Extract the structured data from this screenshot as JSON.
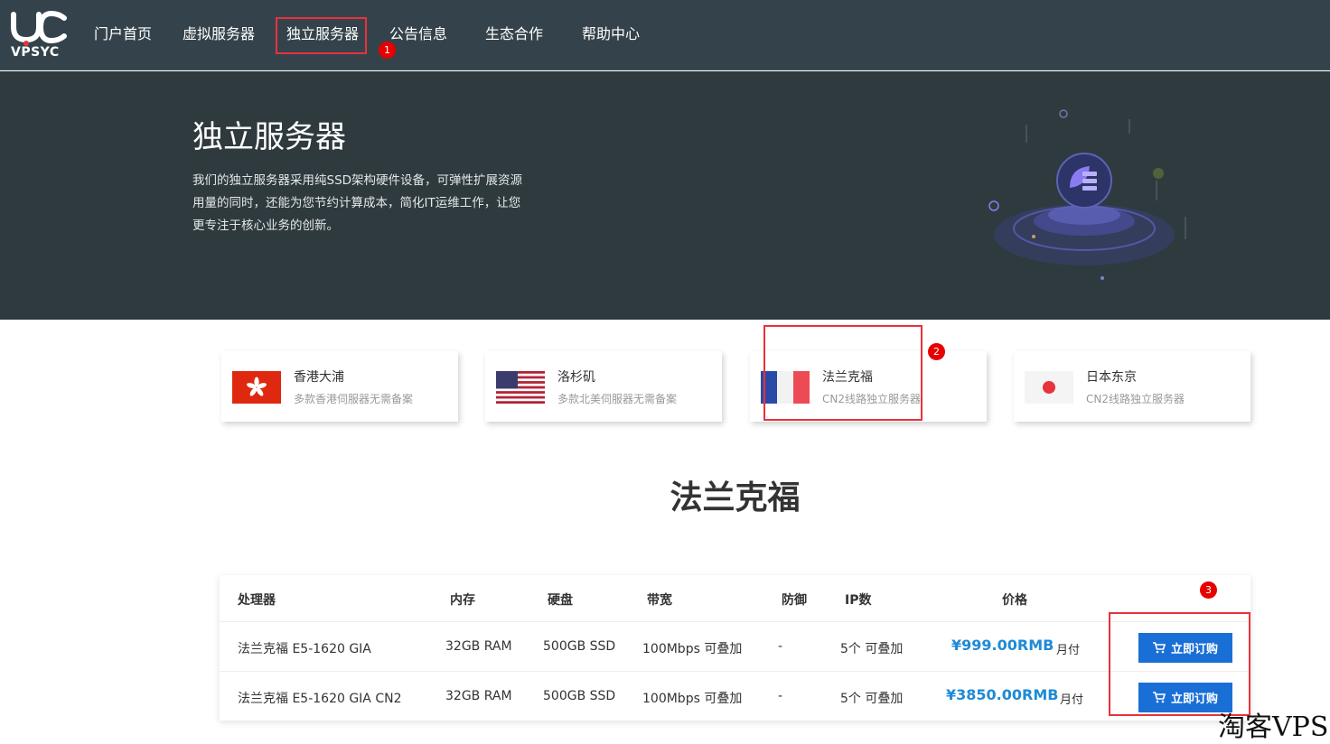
{
  "brand": {
    "logo_text": "VPSYC"
  },
  "nav": {
    "items": [
      {
        "label": "门户首页"
      },
      {
        "label": "虚拟服务器"
      },
      {
        "label": "独立服务器"
      },
      {
        "label": "公告信息"
      },
      {
        "label": "生态合作"
      },
      {
        "label": "帮助中心"
      }
    ]
  },
  "annotations": [
    "1",
    "2",
    "3"
  ],
  "hero": {
    "title": "独立服务器",
    "desc_line1": "我们的独立服务器采用纯SSD架构硬件设备，可弹性扩展资源",
    "desc_line2": "用量的同时，还能为您节约计算成本，简化IT运维工作，让您",
    "desc_line3": "更专注于核心业务的创新。"
  },
  "locations": [
    {
      "title": "香港大浦",
      "sub": "多款香港伺服器无需备案"
    },
    {
      "title": "洛杉矶",
      "sub": "多款北美伺服器无需备案"
    },
    {
      "title": "法兰克福",
      "sub": "CN2线路独立服务器"
    },
    {
      "title": "日本东京",
      "sub": "CN2线路独立服务器"
    }
  ],
  "section_title": "法兰克福",
  "table": {
    "headers": [
      "处理器",
      "内存",
      "硬盘",
      "带宽",
      "防御",
      "IP数",
      "价格"
    ],
    "rows": [
      {
        "cpu": "法兰克福 E5-1620 GIA",
        "ram": "32GB RAM",
        "disk": "500GB SSD",
        "bw": "100Mbps 可叠加",
        "ddos": "-",
        "ip": "5个 可叠加",
        "price": "¥999.00RMB",
        "period": "月付",
        "button": "立即订购"
      },
      {
        "cpu": "法兰克福 E5-1620 GIA CN2",
        "ram": "32GB RAM",
        "disk": "500GB SSD",
        "bw": "100Mbps 可叠加",
        "ddos": "-",
        "ip": "5个 可叠加",
        "price": "¥3850.00RMB",
        "period": "月付",
        "button": "立即订购"
      }
    ]
  },
  "watermark": "淘客VPS",
  "colors": {
    "nav_bg": "#34434b",
    "hero_bg": "#2f3a3f",
    "accent_blue": "#1a6fd6",
    "price_blue": "#1e8ad6",
    "highlight_red": "#e8323c"
  }
}
